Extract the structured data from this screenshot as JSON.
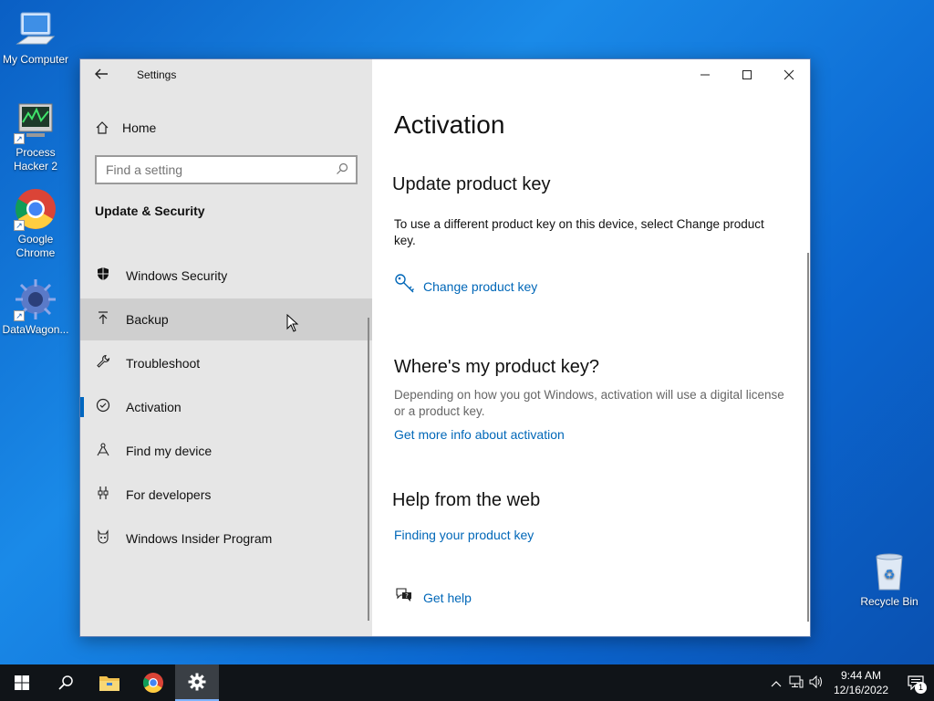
{
  "desktop": {
    "icons": [
      {
        "label": "My Computer",
        "icon": "computer-icon"
      },
      {
        "label": "Process Hacker 2",
        "icon": "process-hacker-icon"
      },
      {
        "label": "Google Chrome",
        "icon": "chrome-icon"
      },
      {
        "label": "DataWagon...",
        "icon": "datawagon-icon"
      },
      {
        "label": "Recycle Bin",
        "icon": "recycle-bin-icon"
      }
    ]
  },
  "window": {
    "title": "Settings",
    "home_label": "Home",
    "search_placeholder": "Find a setting",
    "section_title": "Update & Security",
    "nav_items": [
      {
        "label": "Windows Security",
        "icon": "shield-icon"
      },
      {
        "label": "Backup",
        "icon": "backup-icon"
      },
      {
        "label": "Troubleshoot",
        "icon": "wrench-icon"
      },
      {
        "label": "Activation",
        "icon": "check-circle-icon"
      },
      {
        "label": "Find my device",
        "icon": "find-device-icon"
      },
      {
        "label": "For developers",
        "icon": "developer-icon"
      },
      {
        "label": "Windows Insider Program",
        "icon": "insider-icon"
      }
    ],
    "hovered_item": "Backup",
    "selected_item": "Activation"
  },
  "content": {
    "page_title": "Activation",
    "update_key_heading": "Update product key",
    "update_key_text": "To use a different product key on this device, select Change product key.",
    "change_key_link": "Change product key",
    "where_key_heading": "Where's my product key?",
    "where_key_text": "Depending on how you got Windows, activation will use a digital license or a product key.",
    "more_info_link": "Get more info about activation",
    "help_heading": "Help from the web",
    "finding_key_link": "Finding your product key",
    "get_help_link": "Get help"
  },
  "taskbar": {
    "time": "9:44 AM",
    "date": "12/16/2022",
    "notification_count": "1"
  }
}
